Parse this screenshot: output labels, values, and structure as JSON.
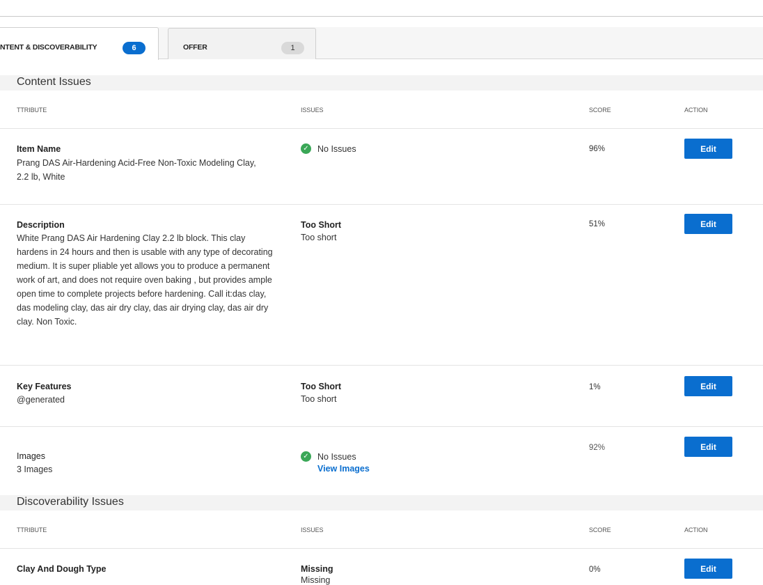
{
  "tabs": [
    {
      "label": "NTENT & DISCOVERABILITY",
      "count": "6"
    },
    {
      "label": "OFFER",
      "count": "1"
    }
  ],
  "content_section": {
    "title": "Content Issues",
    "columns": {
      "attribute": "TTRIBUTE",
      "issues": "ISSUES",
      "score": "SCORE",
      "action": "ACTION"
    },
    "rows": [
      {
        "name": "Item Name",
        "value": "Prang DAS Air-Hardening Acid-Free Non-Toxic Modeling Clay, 2.2 lb, White",
        "issue_text": "No Issues",
        "score": "96%",
        "action": "Edit"
      },
      {
        "name": "Description",
        "value": "White Prang DAS Air Hardening Clay 2.2 lb block. This clay hardens in 24 hours and then is usable with any type of decorating medium. It is super pliable yet allows you to produce a permanent work of art, and does not require oven baking , but provides ample open time to complete projects before hardening. Call it:das clay, das modeling clay, das air dry clay, das air drying clay, das air dry clay. Non Toxic.",
        "issue_title": "Too Short",
        "issue_sub": "Too short",
        "score": "51%",
        "action": "Edit"
      },
      {
        "name": "Key Features",
        "value": "@generated",
        "issue_title": "Too Short",
        "issue_sub": "Too short",
        "score": "1%",
        "action": "Edit"
      },
      {
        "name": "Images",
        "value": "3 Images",
        "issue_text": "No Issues",
        "link": "View Images",
        "score": "92%",
        "action": "Edit"
      }
    ]
  },
  "discoverability_section": {
    "title": "Discoverability Issues",
    "columns": {
      "attribute": "TTRIBUTE",
      "issues": "ISSUES",
      "score": "SCORE",
      "action": "ACTION"
    },
    "rows": [
      {
        "name": "Clay And Dough Type",
        "issue_title": "Missing",
        "issue_sub": "Missing",
        "score": "0%",
        "action": "Edit"
      }
    ]
  },
  "colors": {
    "accent": "#0a6ecf",
    "success": "#3aa757"
  }
}
